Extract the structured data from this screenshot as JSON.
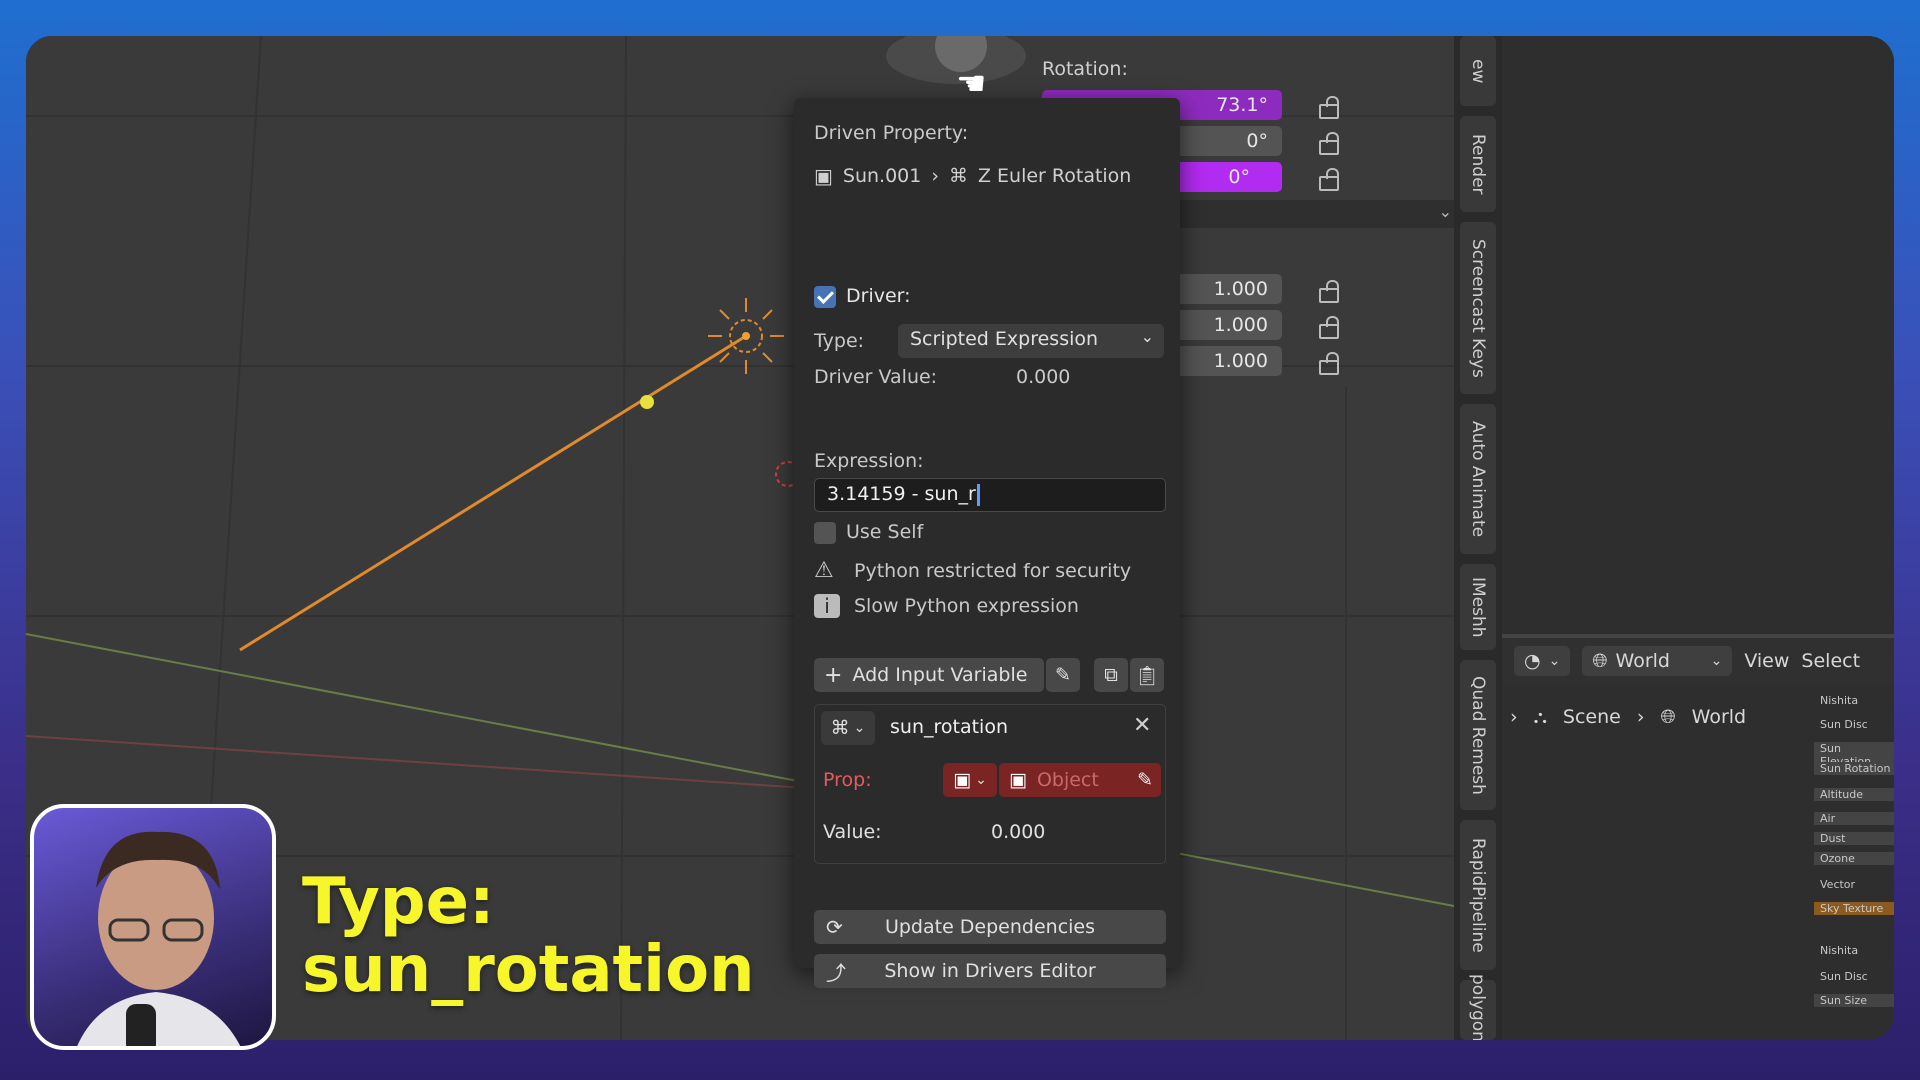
{
  "props": {
    "rotation_label": "Rotation:",
    "rotation_values": [
      "73.1°",
      "0°",
      "0°"
    ],
    "scale_values": [
      "1.000",
      "1.000",
      "1.000"
    ]
  },
  "tabs": [
    "ew",
    "Render",
    "Screencast Keys",
    "Auto Animate",
    "IMeshh",
    "Quad Remesh",
    "RapidPipeline",
    "polygoni"
  ],
  "driver_popup": {
    "driven_property_label": "Driven Property:",
    "object_name": "Sun.001",
    "property_name": "Z Euler Rotation",
    "driver_label": "Driver:",
    "type_label": "Type:",
    "type_value": "Scripted Expression",
    "driver_value_label": "Driver Value:",
    "driver_value": "0.000",
    "expression_label": "Expression:",
    "expression_value": "3.14159 - sun_r",
    "use_self_label": "Use Self",
    "warning_security": "Python restricted for security",
    "warning_slow": "Slow Python expression",
    "add_variable_label": "Add Input Variable",
    "variable": {
      "name": "sun_rotation",
      "prop_label": "Prop:",
      "object_placeholder": "Object",
      "value_label": "Value:",
      "value": "0.000"
    },
    "update_dependencies_label": "Update Dependencies",
    "show_drivers_editor_label": "Show in Drivers Editor"
  },
  "node_editor": {
    "world_label": "World",
    "view_label": "View",
    "select_label": "Select",
    "breadcrumb_scene": "Scene",
    "breadcrumb_world": "World",
    "node_items": [
      "Nishita",
      "Sun Disc",
      "Sun Elevation",
      "Sun Rotation",
      "Altitude",
      "Air",
      "Dust",
      "Ozone",
      "Vector",
      "Sky Texture",
      "Nishita",
      "Sun Disc",
      "Sun Size"
    ]
  },
  "caption": {
    "line1": "Type:",
    "line2": "sun_rotation"
  },
  "colors": {
    "driven_purple": "#8e2bbf",
    "driven_purple_bright": "#b12bf0",
    "checkbox_blue": "#4772b3",
    "caption_yellow": "#f6f62a",
    "light_orange": "#e08a2c"
  }
}
